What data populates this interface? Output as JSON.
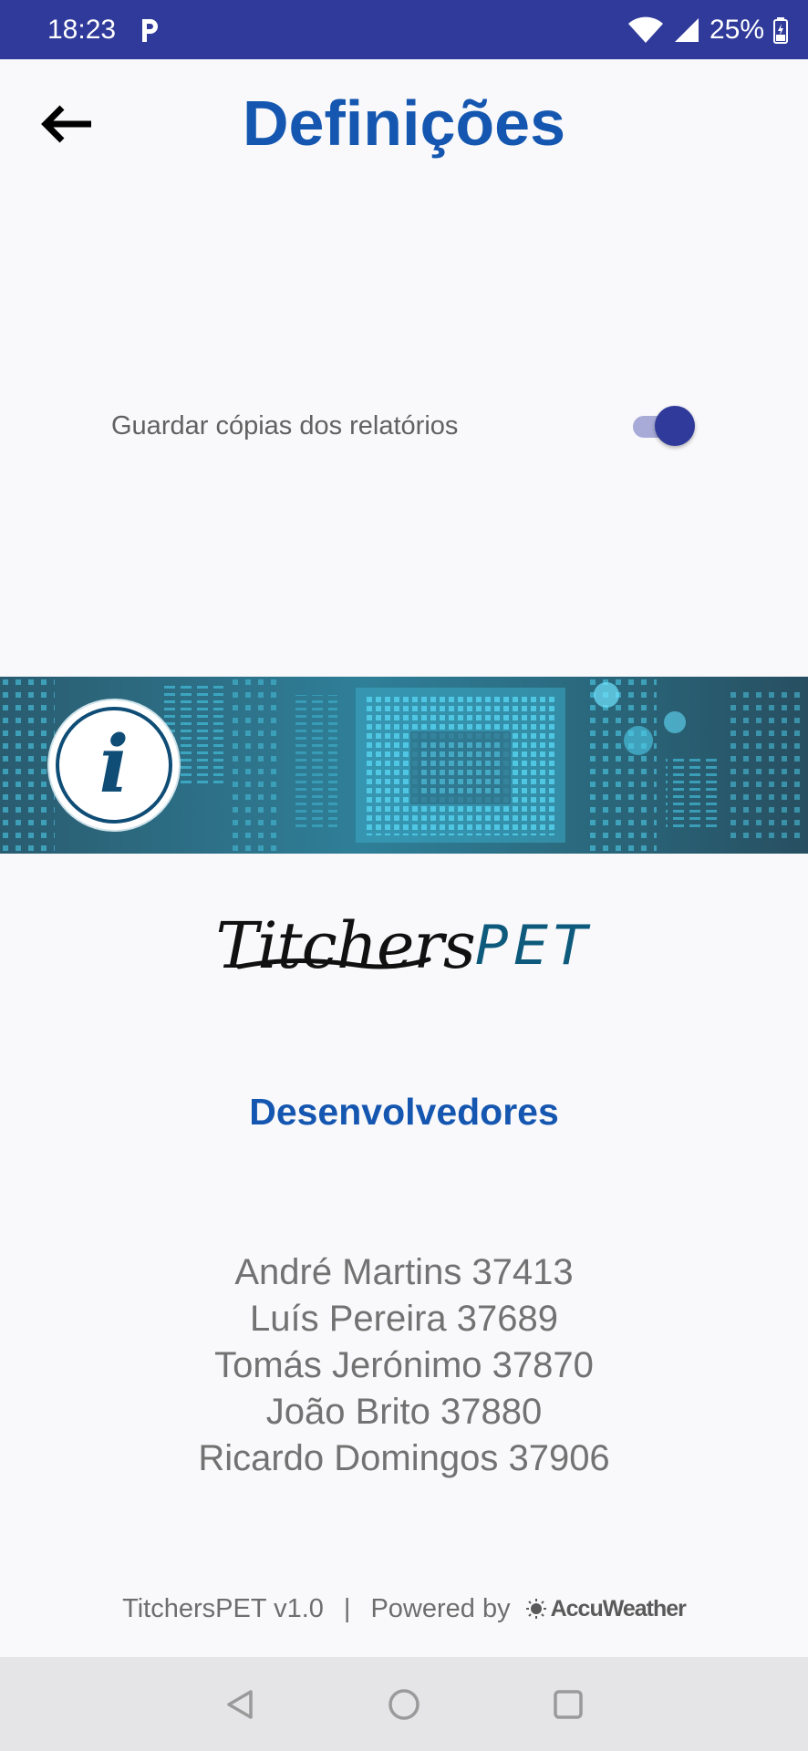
{
  "status_bar": {
    "time": "18:23",
    "battery_percent": "25%",
    "icons": [
      "parking-icon",
      "wifi-icon",
      "signal-icon",
      "battery-icon"
    ]
  },
  "header": {
    "title": "Definições",
    "back_icon": "arrow-left-icon"
  },
  "settings": {
    "save_copies_label": "Guardar cópias dos relatórios",
    "save_copies_enabled": true
  },
  "about": {
    "info_icon": "info-icon",
    "logo_part1": "Titchers",
    "logo_part2": "PET",
    "developers_heading": "Desenvolvedores",
    "developers": [
      "André Martins 37413",
      "Luís Pereira 37689",
      "Tomás Jerónimo 37870",
      "João Brito 37880",
      "Ricardo Domingos 37906"
    ]
  },
  "footer": {
    "version": "TitchersPET v1.0",
    "separator": "|",
    "powered_by": "Powered by",
    "provider": "AccuWeather"
  },
  "nav_bar": {
    "icons": [
      "back-triangle-icon",
      "home-circle-icon",
      "recents-square-icon"
    ]
  },
  "colors": {
    "status_bar": "#2f3a9a",
    "title": "#1557b0",
    "toggle_thumb": "#2f3a9a",
    "toggle_track": "#a8abd8",
    "text_gray": "#727272"
  }
}
